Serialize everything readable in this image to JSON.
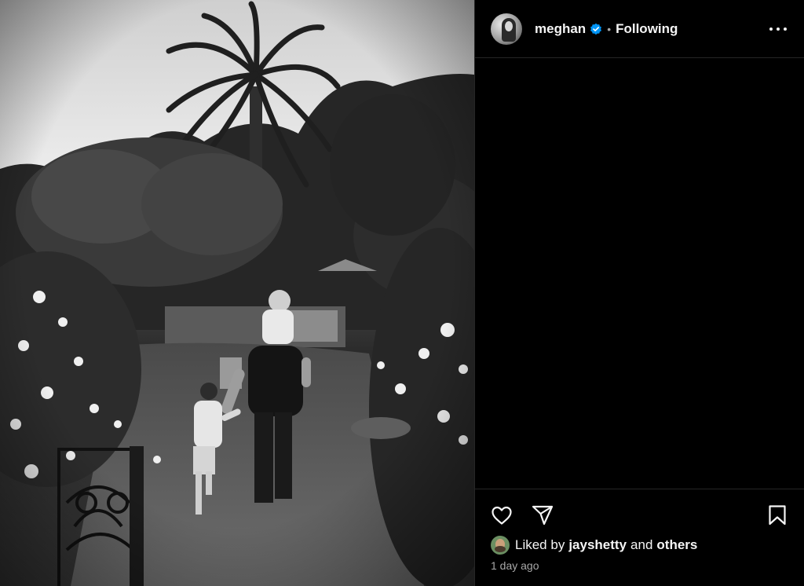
{
  "post": {
    "image_alt": "Black and white garden photo of a family walking",
    "author": {
      "username": "meghan",
      "verified": true,
      "separator": "•",
      "follow_status": "Following"
    },
    "liked_by": {
      "prefix": "Liked by",
      "user": "jayshetty",
      "joiner": "and",
      "suffix": "others"
    },
    "timestamp": "1 day ago"
  },
  "icons": {
    "verified": "verified-badge-icon",
    "more": "more-options-icon",
    "like": "heart-icon",
    "share": "paper-plane-icon",
    "save": "bookmark-icon"
  },
  "colors": {
    "background": "#000000",
    "text": "#f5f5f5",
    "secondary_text": "#a8a8a8",
    "verified_blue": "#0095f6",
    "divider": "#262626"
  }
}
